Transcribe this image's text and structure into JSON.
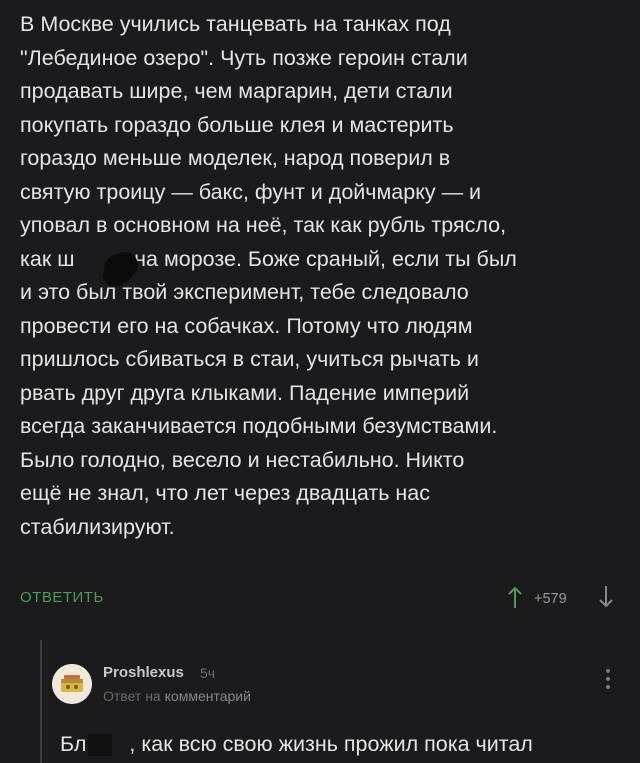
{
  "comment": {
    "text": "В Москве учились танцевать на танках под\n\"Лебединое озеро\". Чуть позже героин стали\nпродавать шире, чем маргарин, дети стали\nпокупать гораздо больше клея и мастерить\nгораздо меньше моделек, народ поверил в\nсвятую троицу — бакс, фунт и дойчмарку — и\nуповал в основном на неё, так как рубль трясло,\nкак ш  у на морозе. Боже сраный, если ты был\nи это был твой эксперимент, тебе следовало\nпровести его на собачках. Потому что людям\nпришлось сбиваться в стаи, учиться рычать и\nрвать друг друга клыками. Падение империй\nвсегда заканчивается подобными безумствами.\nБыло голодно, весело и нестабильно. Никто\nещё не знал, что лет через двадцать нас\nстабилизируют.",
    "reply_label": "ОТВЕТИТЬ",
    "rating": "+579",
    "vote_up_icon": "arrow-up-icon",
    "vote_down_icon": "arrow-down-icon",
    "accent_color": "#4f9a55"
  },
  "reply": {
    "username": "Proshlexus",
    "time_ago": "5ч",
    "reply_to_prefix": "Ответ на",
    "reply_to_link": "комментарий",
    "text": "Бл  , как всю свою жизнь прожил пока читал",
    "avatar_icon": "avatar-icon",
    "menu_icon": "more-vertical-icon"
  }
}
